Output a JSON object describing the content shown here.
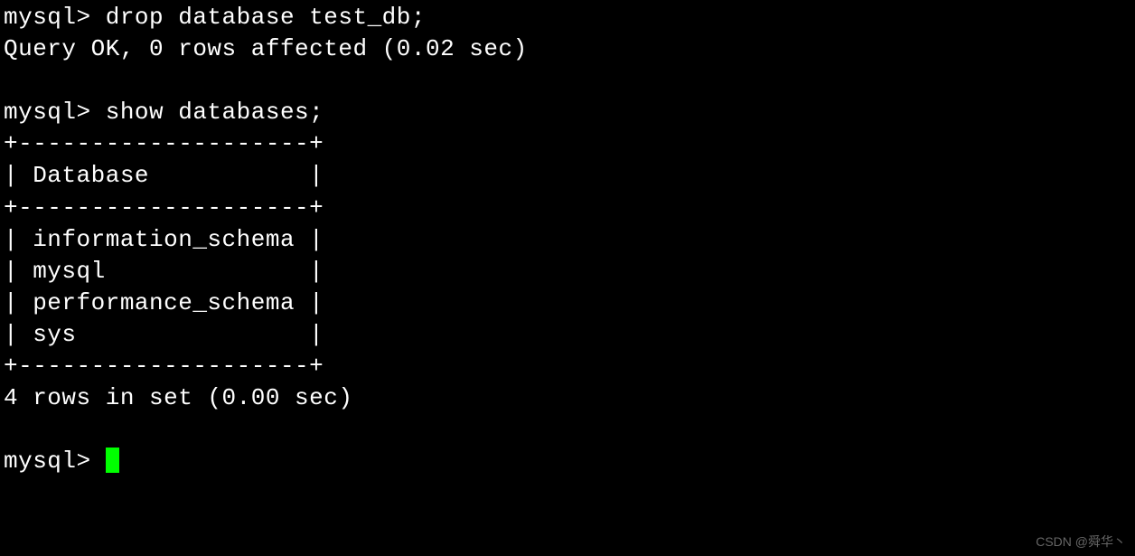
{
  "terminal": {
    "prompt": "mysql> ",
    "command1": "drop database test_db;",
    "result1": "Query OK, 0 rows affected (0.02 sec)",
    "command2": "show databases;",
    "table": {
      "border": "+--------------------+",
      "header": "| Database           |",
      "rows": [
        "| information_schema |",
        "| mysql              |",
        "| performance_schema |",
        "| sys                |"
      ]
    },
    "result2": "4 rows in set (0.00 sec)"
  },
  "watermark": "CSDN @舜华丶"
}
